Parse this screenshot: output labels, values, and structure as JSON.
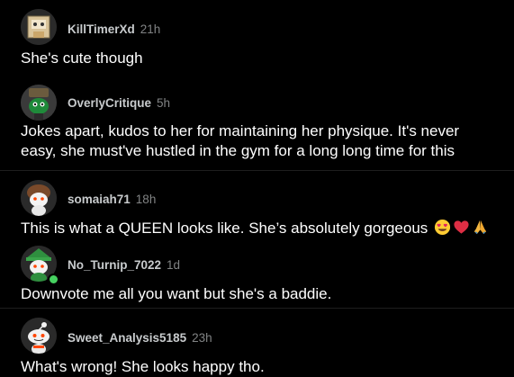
{
  "colors": {
    "background": "#000000",
    "text": "#ffffff",
    "username": "#c8cbcd",
    "timestamp": "#818384",
    "online": "#46d160"
  },
  "comments": [
    {
      "username": "KillTimerXd",
      "age": "21h",
      "text": "She's cute though",
      "avatar_icon": "avatar-box-character-icon"
    },
    {
      "username": "OverlyCritique",
      "age": "5h",
      "lines": [
        "Jokes apart, kudos to her for maintaining her physique. It's never",
        "easy, she must've hustled in the gym for a long long time for this"
      ],
      "avatar_icon": "avatar-green-snoo-hat-icon"
    },
    {
      "username": "somaiah71",
      "age": "18h",
      "text": "This is what a QUEEN looks like. She’s absolutely gorgeous",
      "emojis": [
        "heart-eyes-emoji",
        "red-heart-emoji",
        "folded-hands-emoji"
      ],
      "avatar_icon": "avatar-snoo-brown-hair-icon"
    },
    {
      "username": "No_Turnip_7022",
      "age": "1d",
      "text": "Downvote me all you want but she's a baddie.",
      "avatar_icon": "avatar-snoo-green-cap-icon",
      "online": true
    },
    {
      "username": "Sweet_Analysis5185",
      "age": "23h",
      "text": "What's wrong! She looks happy tho.",
      "avatar_icon": "avatar-snoo-default-icon"
    }
  ]
}
